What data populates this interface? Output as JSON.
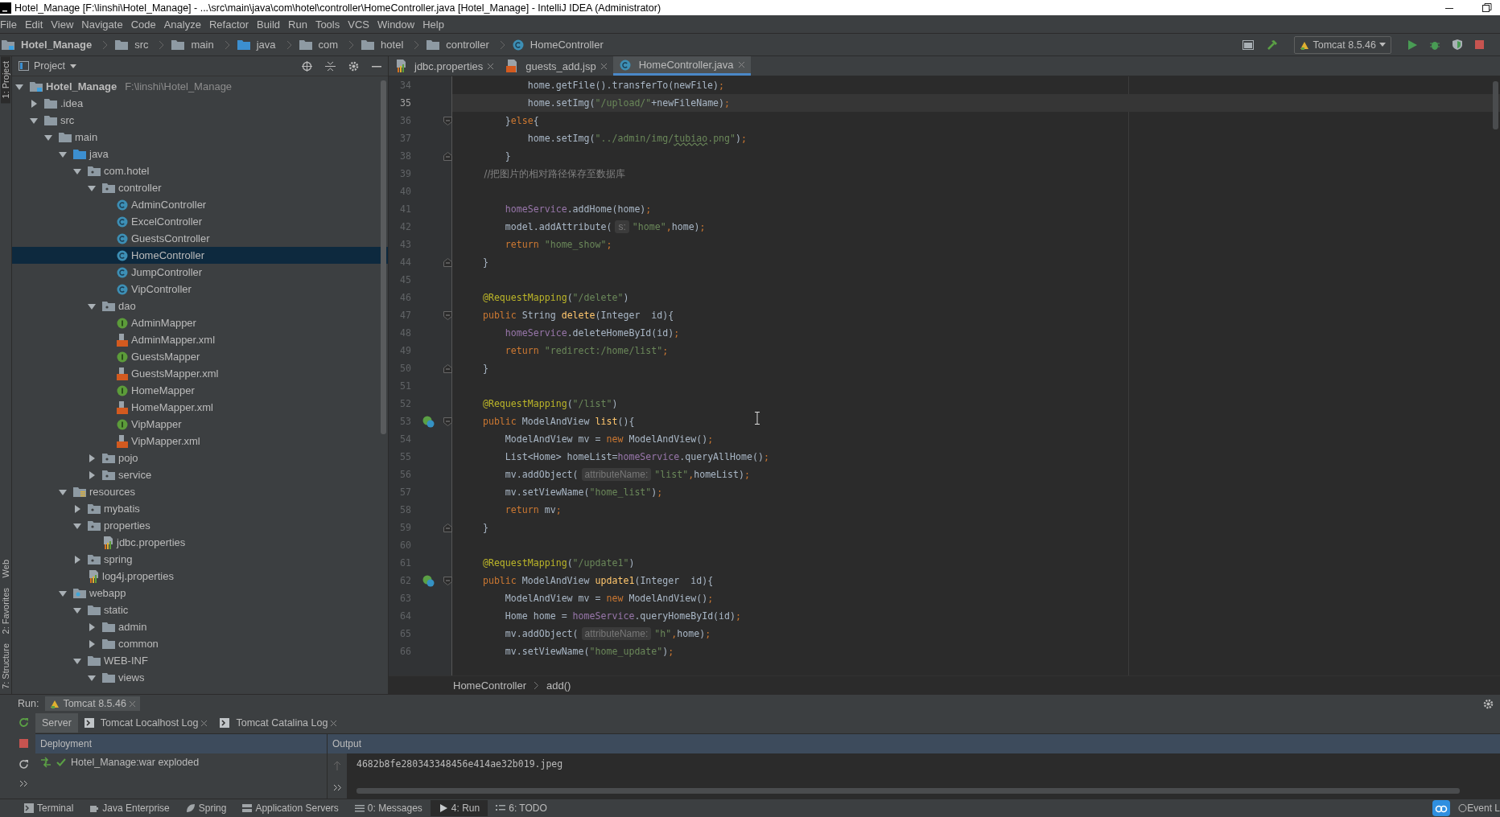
{
  "window": {
    "title": "Hotel_Manage [F:\\linshi\\Hotel_Manage] - ...\\src\\main\\java\\com\\hotel\\controller\\HomeController.java [Hotel_Manage] - IntelliJ IDEA (Administrator)"
  },
  "menu": [
    "File",
    "Edit",
    "View",
    "Navigate",
    "Code",
    "Analyze",
    "Refactor",
    "Build",
    "Run",
    "Tools",
    "VCS",
    "Window",
    "Help"
  ],
  "nav_bar": {
    "crumbs": [
      {
        "label": "Hotel_Manage",
        "kind": "module"
      },
      {
        "label": "src",
        "kind": "folder"
      },
      {
        "label": "main",
        "kind": "folder"
      },
      {
        "label": "java",
        "kind": "source"
      },
      {
        "label": "com",
        "kind": "folder"
      },
      {
        "label": "hotel",
        "kind": "folder"
      },
      {
        "label": "controller",
        "kind": "folder"
      },
      {
        "label": "HomeController",
        "kind": "class"
      }
    ],
    "run_config": "Tomcat 8.5.46"
  },
  "side_strip": [
    {
      "label": "1: Project",
      "selected": true
    },
    {
      "label": "Web",
      "selected": false
    },
    {
      "label": "2: Favorites",
      "selected": false
    },
    {
      "label": "7: Structure",
      "selected": false
    }
  ],
  "project": {
    "title": "Project",
    "tree": [
      {
        "label": "Hotel_Manage",
        "path": "F:\\linshi\\Hotel_Manage",
        "kind": "module",
        "expanded": true,
        "selected": false,
        "children": [
          {
            "label": ".idea",
            "kind": "folder",
            "expanded": false,
            "selected": false
          },
          {
            "label": "src",
            "kind": "folder",
            "expanded": true,
            "selected": false,
            "children": [
              {
                "label": "main",
                "kind": "folder",
                "expanded": true,
                "selected": false,
                "children": [
                  {
                    "label": "java",
                    "kind": "source",
                    "expanded": true,
                    "selected": false,
                    "children": [
                      {
                        "label": "com.hotel",
                        "kind": "package",
                        "expanded": true,
                        "selected": false,
                        "children": [
                          {
                            "label": "controller",
                            "kind": "package",
                            "expanded": true,
                            "selected": false,
                            "children": [
                              {
                                "label": "AdminController",
                                "kind": "class",
                                "selected": false
                              },
                              {
                                "label": "ExcelController",
                                "kind": "class",
                                "selected": false
                              },
                              {
                                "label": "GuestsController",
                                "kind": "class",
                                "selected": false
                              },
                              {
                                "label": "HomeController",
                                "kind": "class",
                                "selected": true
                              },
                              {
                                "label": "JumpController",
                                "kind": "class",
                                "selected": false
                              },
                              {
                                "label": "VipController",
                                "kind": "class",
                                "selected": false
                              }
                            ]
                          },
                          {
                            "label": "dao",
                            "kind": "package",
                            "expanded": true,
                            "selected": false,
                            "children": [
                              {
                                "label": "AdminMapper",
                                "kind": "interface",
                                "selected": false
                              },
                              {
                                "label": "AdminMapper.xml",
                                "kind": "xml",
                                "selected": false
                              },
                              {
                                "label": "GuestsMapper",
                                "kind": "interface",
                                "selected": false
                              },
                              {
                                "label": "GuestsMapper.xml",
                                "kind": "xml",
                                "selected": false
                              },
                              {
                                "label": "HomeMapper",
                                "kind": "interface",
                                "selected": false
                              },
                              {
                                "label": "HomeMapper.xml",
                                "kind": "xml",
                                "selected": false
                              },
                              {
                                "label": "VipMapper",
                                "kind": "interface",
                                "selected": false
                              },
                              {
                                "label": "VipMapper.xml",
                                "kind": "xml",
                                "selected": false
                              }
                            ]
                          },
                          {
                            "label": "pojo",
                            "kind": "package",
                            "expanded": false,
                            "selected": false
                          },
                          {
                            "label": "service",
                            "kind": "package",
                            "expanded": false,
                            "selected": false
                          }
                        ]
                      }
                    ]
                  },
                  {
                    "label": "resources",
                    "kind": "resources",
                    "expanded": true,
                    "selected": false,
                    "children": [
                      {
                        "label": "mybatis",
                        "kind": "package",
                        "expanded": false,
                        "selected": false
                      },
                      {
                        "label": "properties",
                        "kind": "package",
                        "expanded": true,
                        "selected": false,
                        "children": [
                          {
                            "label": "jdbc.properties",
                            "kind": "properties",
                            "selected": false
                          }
                        ]
                      },
                      {
                        "label": "spring",
                        "kind": "package",
                        "expanded": false,
                        "selected": false
                      },
                      {
                        "label": "log4j.properties",
                        "kind": "properties",
                        "selected": false
                      }
                    ]
                  },
                  {
                    "label": "webapp",
                    "kind": "web",
                    "expanded": true,
                    "selected": false,
                    "children": [
                      {
                        "label": "static",
                        "kind": "folder",
                        "expanded": true,
                        "selected": false,
                        "children": [
                          {
                            "label": "admin",
                            "kind": "folder",
                            "expanded": false,
                            "selected": false
                          },
                          {
                            "label": "common",
                            "kind": "folder",
                            "expanded": false,
                            "selected": false
                          }
                        ]
                      },
                      {
                        "label": "WEB-INF",
                        "kind": "folder",
                        "expanded": true,
                        "selected": false,
                        "children": [
                          {
                            "label": "views",
                            "kind": "folder",
                            "expanded": true,
                            "selected": false
                          }
                        ]
                      }
                    ]
                  }
                ]
              }
            ]
          }
        ]
      }
    ]
  },
  "editor": {
    "tabs": [
      {
        "label": "jdbc.properties",
        "kind": "properties",
        "selected": false
      },
      {
        "label": "guests_add.jsp",
        "kind": "jsp",
        "selected": false
      },
      {
        "label": "HomeController.java",
        "kind": "class",
        "selected": true
      }
    ],
    "lines": [
      {
        "number": "34",
        "current": false,
        "tokens": [
          {
            "kind": "t",
            "text": "            home.getFile().transferTo(newFile)"
          },
          {
            "kind": "p",
            "text": ";"
          }
        ]
      },
      {
        "number": "35",
        "current": true,
        "tokens": [
          {
            "kind": "t",
            "text": "            home.setImg("
          },
          {
            "kind": "str",
            "text": "\"/upload/\""
          },
          {
            "kind": "t",
            "text": "+newFileName)"
          },
          {
            "kind": "p",
            "text": ";"
          }
        ]
      },
      {
        "number": "36",
        "current": false,
        "fold_start": true,
        "tokens": [
          {
            "kind": "t",
            "text": "        }"
          },
          {
            "kind": "kw",
            "text": "else"
          },
          {
            "kind": "t",
            "text": "{"
          }
        ]
      },
      {
        "number": "37",
        "current": false,
        "tokens": [
          {
            "kind": "t",
            "text": "            home.setImg("
          },
          {
            "kind": "str",
            "text": "\"../admin/img/"
          },
          {
            "kind": "strw",
            "text": "tubiao"
          },
          {
            "kind": "str",
            "text": ".png\""
          },
          {
            "kind": "t",
            "text": ")"
          },
          {
            "kind": "p",
            "text": ";"
          }
        ]
      },
      {
        "number": "38",
        "current": false,
        "fold_end": true,
        "tokens": [
          {
            "kind": "t",
            "text": "        }"
          }
        ]
      },
      {
        "number": "39",
        "current": false,
        "tokens": [
          {
            "kind": "cmt",
            "text": "        //把图片的相对路径保存至数据库"
          }
        ]
      },
      {
        "number": "40",
        "current": false
      },
      {
        "number": "41",
        "current": false,
        "tokens": [
          {
            "kind": "fld",
            "text": "        homeService"
          },
          {
            "kind": "t",
            "text": ".addHome(home)"
          },
          {
            "kind": "p",
            "text": ";"
          }
        ]
      },
      {
        "number": "42",
        "current": false,
        "tokens": [
          {
            "kind": "t",
            "text": "        model.addAttribute("
          },
          {
            "kind": "hint",
            "text": "s:"
          },
          {
            "kind": "str",
            "text": "\"home\""
          },
          {
            "kind": "p",
            "text": ","
          },
          {
            "kind": "t",
            "text": "home)"
          },
          {
            "kind": "p",
            "text": ";"
          }
        ]
      },
      {
        "number": "43",
        "current": false,
        "tokens": [
          {
            "kind": "kw",
            "text": "        return "
          },
          {
            "kind": "str",
            "text": "\"home_show\""
          },
          {
            "kind": "p",
            "text": ";"
          }
        ]
      },
      {
        "number": "44",
        "current": false,
        "fold_end": true,
        "tokens": [
          {
            "kind": "t",
            "text": "    }"
          }
        ]
      },
      {
        "number": "45",
        "current": false
      },
      {
        "number": "46",
        "current": false,
        "tokens": [
          {
            "kind": "ann",
            "text": "    @RequestMapping"
          },
          {
            "kind": "t",
            "text": "("
          },
          {
            "kind": "str",
            "text": "\"/delete\""
          },
          {
            "kind": "t",
            "text": ")"
          }
        ]
      },
      {
        "number": "47",
        "current": false,
        "fold_start": true,
        "tokens": [
          {
            "kind": "kw",
            "text": "    public "
          },
          {
            "kind": "t",
            "text": "String "
          },
          {
            "kind": "decl",
            "text": "delete"
          },
          {
            "kind": "t",
            "text": "(Integer  id){"
          }
        ]
      },
      {
        "number": "48",
        "current": false,
        "tokens": [
          {
            "kind": "fld",
            "text": "        homeService"
          },
          {
            "kind": "t",
            "text": ".deleteHomeById(id)"
          },
          {
            "kind": "p",
            "text": ";"
          }
        ]
      },
      {
        "number": "49",
        "current": false,
        "tokens": [
          {
            "kind": "kw",
            "text": "        return "
          },
          {
            "kind": "str",
            "text": "\"redirect:/home/list\""
          },
          {
            "kind": "p",
            "text": ";"
          }
        ]
      },
      {
        "number": "50",
        "current": false,
        "fold_end": true,
        "tokens": [
          {
            "kind": "t",
            "text": "    }"
          }
        ]
      },
      {
        "number": "51",
        "current": false
      },
      {
        "number": "52",
        "current": false,
        "tokens": [
          {
            "kind": "ann",
            "text": "    @RequestMapping"
          },
          {
            "kind": "t",
            "text": "("
          },
          {
            "kind": "str",
            "text": "\"/list\""
          },
          {
            "kind": "t",
            "text": ")"
          }
        ]
      },
      {
        "number": "53",
        "current": false,
        "fold_start": true,
        "endpoint": true,
        "tokens": [
          {
            "kind": "kw",
            "text": "    public "
          },
          {
            "kind": "t",
            "text": "ModelAndView "
          },
          {
            "kind": "decl",
            "text": "list"
          },
          {
            "kind": "t",
            "text": "(){"
          }
        ]
      },
      {
        "number": "54",
        "current": false,
        "tokens": [
          {
            "kind": "t",
            "text": "        ModelAndView mv = "
          },
          {
            "kind": "kw",
            "text": "new "
          },
          {
            "kind": "t",
            "text": "ModelAndView()"
          },
          {
            "kind": "p",
            "text": ";"
          }
        ]
      },
      {
        "number": "55",
        "current": false,
        "tokens": [
          {
            "kind": "t",
            "text": "        List<Home> homeList="
          },
          {
            "kind": "fld",
            "text": "homeService"
          },
          {
            "kind": "t",
            "text": ".queryAllHome()"
          },
          {
            "kind": "p",
            "text": ";"
          }
        ]
      },
      {
        "number": "56",
        "current": false,
        "tokens": [
          {
            "kind": "t",
            "text": "        mv.addObject("
          },
          {
            "kind": "hint",
            "text": "attributeName:"
          },
          {
            "kind": "str",
            "text": "\"list\""
          },
          {
            "kind": "p",
            "text": ","
          },
          {
            "kind": "t",
            "text": "homeList)"
          },
          {
            "kind": "p",
            "text": ";"
          }
        ]
      },
      {
        "number": "57",
        "current": false,
        "tokens": [
          {
            "kind": "t",
            "text": "        mv.setViewName("
          },
          {
            "kind": "str",
            "text": "\"home_list\""
          },
          {
            "kind": "t",
            "text": ")"
          },
          {
            "kind": "p",
            "text": ";"
          }
        ]
      },
      {
        "number": "58",
        "current": false,
        "tokens": [
          {
            "kind": "kw",
            "text": "        return "
          },
          {
            "kind": "t",
            "text": "mv"
          },
          {
            "kind": "p",
            "text": ";"
          }
        ]
      },
      {
        "number": "59",
        "current": false,
        "fold_end": true,
        "tokens": [
          {
            "kind": "t",
            "text": "    }"
          }
        ]
      },
      {
        "number": "60",
        "current": false
      },
      {
        "number": "61",
        "current": false,
        "tokens": [
          {
            "kind": "ann",
            "text": "    @RequestMapping"
          },
          {
            "kind": "t",
            "text": "("
          },
          {
            "kind": "str",
            "text": "\"/update1\""
          },
          {
            "kind": "t",
            "text": ")"
          }
        ]
      },
      {
        "number": "62",
        "current": false,
        "fold_start": true,
        "endpoint": true,
        "tokens": [
          {
            "kind": "kw",
            "text": "    public "
          },
          {
            "kind": "t",
            "text": "ModelAndView "
          },
          {
            "kind": "decl",
            "text": "update1"
          },
          {
            "kind": "t",
            "text": "(Integer  id){"
          }
        ]
      },
      {
        "number": "63",
        "current": false,
        "tokens": [
          {
            "kind": "t",
            "text": "        ModelAndView mv = "
          },
          {
            "kind": "kw",
            "text": "new "
          },
          {
            "kind": "t",
            "text": "ModelAndView()"
          },
          {
            "kind": "p",
            "text": ";"
          }
        ]
      },
      {
        "number": "64",
        "current": false,
        "tokens": [
          {
            "kind": "t",
            "text": "        Home home = "
          },
          {
            "kind": "fld",
            "text": "homeService"
          },
          {
            "kind": "t",
            "text": ".queryHomeById(id)"
          },
          {
            "kind": "p",
            "text": ";"
          }
        ]
      },
      {
        "number": "65",
        "current": false,
        "tokens": [
          {
            "kind": "t",
            "text": "        mv.addObject("
          },
          {
            "kind": "hint",
            "text": "attributeName:"
          },
          {
            "kind": "str",
            "text": "\"h\""
          },
          {
            "kind": "p",
            "text": ","
          },
          {
            "kind": "t",
            "text": "home)"
          },
          {
            "kind": "p",
            "text": ";"
          }
        ]
      },
      {
        "number": "66",
        "current": false,
        "tokens": [
          {
            "kind": "t",
            "text": "        mv.setViewName("
          },
          {
            "kind": "str",
            "text": "\"home_update\""
          },
          {
            "kind": "t",
            "text": ")"
          },
          {
            "kind": "p",
            "text": ";"
          }
        ]
      }
    ],
    "breadcrumb": [
      "HomeController",
      "add()"
    ]
  },
  "run_panel": {
    "label": "Run:",
    "tab": "Tomcat 8.5.46",
    "tabs": [
      {
        "label": "Server",
        "kind": "plain",
        "selected": true
      },
      {
        "label": "Tomcat Localhost Log",
        "kind": "log",
        "selected": false
      },
      {
        "label": "Tomcat Catalina Log",
        "kind": "log",
        "selected": false
      }
    ],
    "deployment_header": "Deployment",
    "output_header": "Output",
    "deployment": "Hotel_Manage:war exploded",
    "output": "4682b8fe280343348456e414ae32b019.jpeg"
  },
  "status_bar": {
    "items": [
      {
        "label": "Terminal",
        "kind": "terminal",
        "selected": false
      },
      {
        "label": "Java Enterprise",
        "kind": "javaee",
        "selected": false
      },
      {
        "label": "Spring",
        "kind": "spring",
        "selected": false
      },
      {
        "label": "Application Servers",
        "kind": "server",
        "selected": false
      },
      {
        "label": "0: Messages",
        "kind": "messages",
        "selected": false
      },
      {
        "label": "4: Run",
        "kind": "run",
        "selected": true
      },
      {
        "label": "6: TODO",
        "kind": "todo",
        "selected": false
      }
    ],
    "event_log": "Event L"
  }
}
